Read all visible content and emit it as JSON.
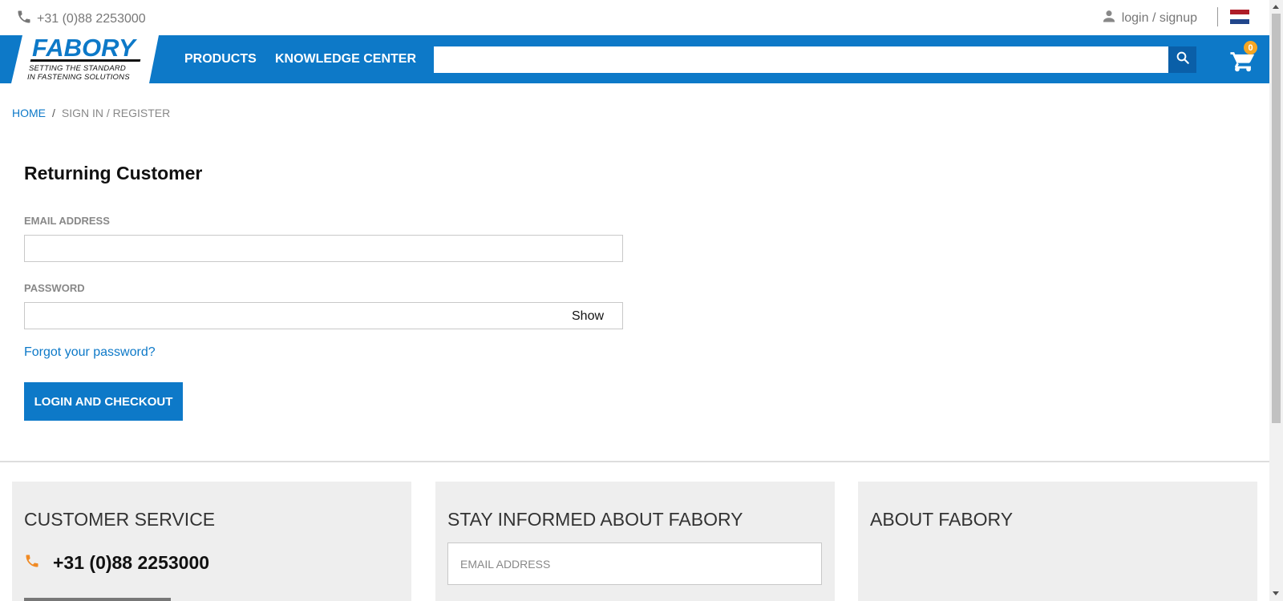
{
  "topbar": {
    "phone": "+31 (0)88 2253000",
    "login_label": "login / signup",
    "flag_colors": [
      "#ae1c28",
      "#ffffff",
      "#21468b"
    ]
  },
  "brand": {
    "name": "FABORY",
    "tagline_1": "SETTING THE STANDARD",
    "tagline_2": "IN FASTENING SOLUTIONS"
  },
  "nav": {
    "items": [
      {
        "label": "PRODUCTS"
      },
      {
        "label": "KNOWLEDGE CENTER"
      }
    ],
    "search_placeholder": "",
    "cart_count": "0"
  },
  "breadcrumb": {
    "home": "HOME",
    "separator": "/",
    "current": "SIGN IN / REGISTER"
  },
  "login_form": {
    "title": "Returning Customer",
    "email_label": "EMAIL ADDRESS",
    "email_value": "",
    "password_label": "PASSWORD",
    "password_value": "",
    "show_label": "Show",
    "forgot_label": "Forgot your password?",
    "submit_label": "LOGIN AND CHECKOUT"
  },
  "footer": {
    "customer_service": {
      "title": "CUSTOMER SERVICE",
      "phone": "+31 (0)88 2253000"
    },
    "newsletter": {
      "title": "STAY INFORMED ABOUT FABORY",
      "placeholder": "EMAIL ADDRESS"
    },
    "about": {
      "title": "ABOUT FABORY"
    }
  },
  "colors": {
    "brand_blue": "#0d79c8",
    "search_button": "#0a5fa8",
    "badge": "#f5a623",
    "phone_icon_footer": "#f08a24"
  }
}
